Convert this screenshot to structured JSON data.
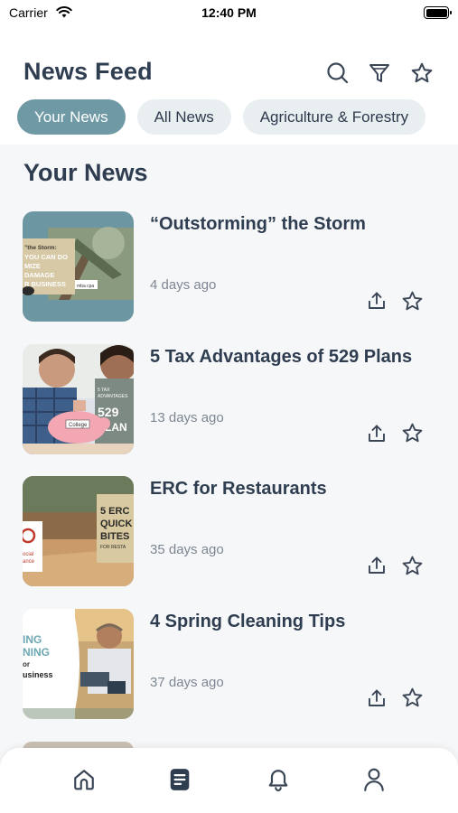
{
  "status_bar": {
    "carrier": "Carrier",
    "time": "12:40 PM",
    "battery_level": 1.0
  },
  "header": {
    "title": "News Feed",
    "icons": [
      "search-icon",
      "filter-icon",
      "star-icon"
    ]
  },
  "chips": [
    {
      "label": "Your News",
      "active": true
    },
    {
      "label": "All News",
      "active": false
    },
    {
      "label": "Agriculture & Forestry",
      "active": false
    }
  ],
  "section_title": "Your News",
  "articles": [
    {
      "title": "“Outstorming” the Storm",
      "time_ago": "4 days ago",
      "thumb_text": "”the Storm: YOU CAN DO MIZE DAMAGE R BUSINESS"
    },
    {
      "title": "5 Tax Advantages of 529 Plans",
      "time_ago": "13 days ago",
      "thumb_text": "5 TAX ADVANTAGES 529 PLAN College"
    },
    {
      "title": "ERC for Restaurants",
      "time_ago": "35 days ago",
      "thumb_text": "5 ERC QUICK BITES FOR RESTA"
    },
    {
      "title": "4 Spring Cleaning Tips",
      "time_ago": "37 days ago",
      "thumb_text": "ING NING or usiness"
    }
  ],
  "tabbar": {
    "icons": [
      "home-icon",
      "news-icon",
      "bell-icon",
      "profile-icon"
    ],
    "active": "news-icon"
  },
  "colors": {
    "accent": "#6f9aa5",
    "title": "#2f3d51",
    "muted": "#7d8794",
    "chip_bg": "#e9eef1",
    "icon": "#3a4556"
  }
}
